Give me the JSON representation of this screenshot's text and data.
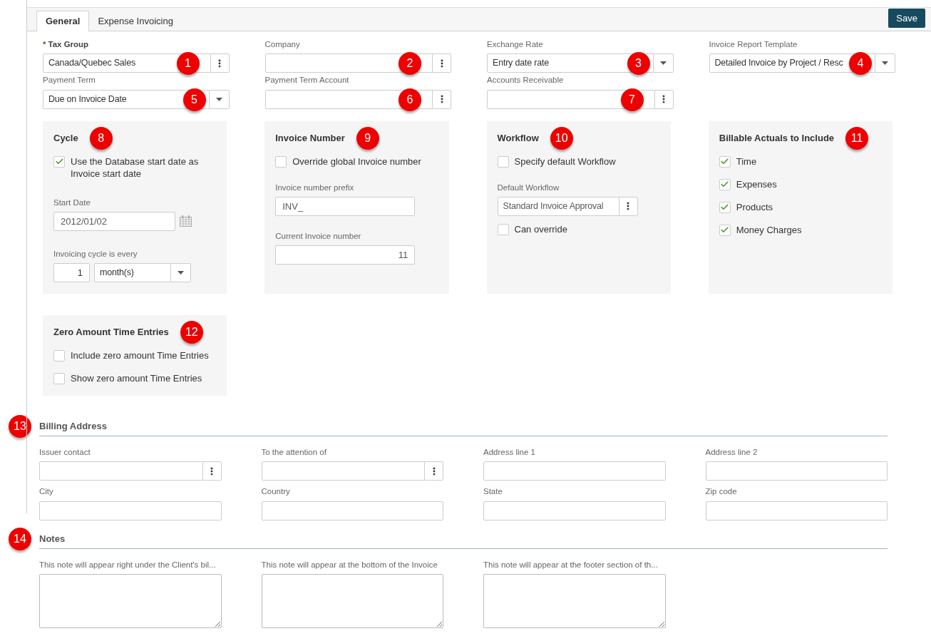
{
  "tabs": [
    {
      "label": "General",
      "selected": true
    },
    {
      "label": "Expense Invoicing",
      "selected": false
    }
  ],
  "save_button": "Save",
  "field_rows": [
    [
      {
        "label": "Tax Group",
        "required_mark": "*",
        "kind": "lookup",
        "value": "Canada/Quebec Sales",
        "marker": "1"
      },
      {
        "label": "Company",
        "kind": "lookup",
        "marker": "2"
      },
      {
        "label": "Exchange Rate",
        "kind": "dropdown",
        "value": "Entry date rate",
        "marker": "3"
      },
      {
        "label": "Invoice Report Template",
        "kind": "dropdown",
        "value": "Detailed Invoice by Project / Resc",
        "marker": "4"
      }
    ],
    [
      {
        "label": "Payment Term",
        "kind": "dropdown",
        "value": "Due on Invoice Date",
        "marker": "5"
      },
      {
        "label": "Payment Term Account",
        "kind": "lookup",
        "marker": "6"
      },
      {
        "label": "Accounts Receivable",
        "kind": "lookup",
        "marker": "7"
      }
    ]
  ],
  "panels": [
    {
      "title": "Cycle",
      "marker": "8",
      "items": [
        {
          "kind": "checkbox",
          "label": "Use the Database start date as Invoice start date",
          "checked": true
        },
        {
          "kind": "date",
          "label": "Start Date",
          "value": "2012/01/02"
        },
        {
          "kind": "cycle",
          "label": "Invoicing cycle is every",
          "count": "1",
          "unit": "month(s)"
        }
      ]
    },
    {
      "title": "Invoice Number",
      "marker": "9",
      "items": [
        {
          "kind": "checkbox",
          "label": "Override global Invoice number",
          "checked": false
        },
        {
          "kind": "text",
          "label": "Invoice number prefix",
          "value": "INV_"
        },
        {
          "kind": "number",
          "label": "Current Invoice number",
          "value": "11"
        }
      ]
    },
    {
      "title": "Workflow",
      "marker": "10",
      "items": [
        {
          "kind": "checkbox",
          "label": "Specify default Workflow",
          "checked": false
        },
        {
          "kind": "lookup",
          "label": "Default Workflow",
          "value": "Standard Invoice Approval"
        },
        {
          "kind": "checkbox",
          "label": "Can override",
          "checked": false
        }
      ]
    },
    {
      "title": "Billable Actuals to Include",
      "marker": "11",
      "items": [
        {
          "kind": "checkbox",
          "label": "Time",
          "checked": true
        },
        {
          "kind": "checkbox",
          "label": "Expenses",
          "checked": true
        },
        {
          "kind": "checkbox",
          "label": "Products",
          "checked": true
        },
        {
          "kind": "checkbox",
          "label": "Money Charges",
          "checked": true
        }
      ]
    },
    {
      "title": "Zero Amount Time Entries",
      "marker": "12",
      "items": [
        {
          "kind": "checkbox",
          "label": "Include zero amount Time Entries",
          "checked": false
        },
        {
          "kind": "checkbox",
          "label": "Show zero amount Time Entries",
          "checked": false
        }
      ]
    }
  ],
  "billing": {
    "title": "Billing Address",
    "marker": "13",
    "fields": [
      {
        "label": "Issuer contact",
        "kind": "lookup"
      },
      {
        "label": "To the attention of",
        "kind": "lookup"
      },
      {
        "label": "Address line 1",
        "kind": "text"
      },
      {
        "label": "Address line 2",
        "kind": "text"
      },
      {
        "label": "City",
        "kind": "text"
      },
      {
        "label": "Country",
        "kind": "text"
      },
      {
        "label": "State",
        "kind": "text"
      },
      {
        "label": "Zip code",
        "kind": "text"
      }
    ]
  },
  "notes": {
    "title": "Notes",
    "marker": "14",
    "fields": [
      {
        "label": "This note will appear right under the Client's bil..."
      },
      {
        "label": "This note will appear at the bottom of the Invoice"
      },
      {
        "label": "This note will appear at the footer section of th..."
      }
    ]
  }
}
